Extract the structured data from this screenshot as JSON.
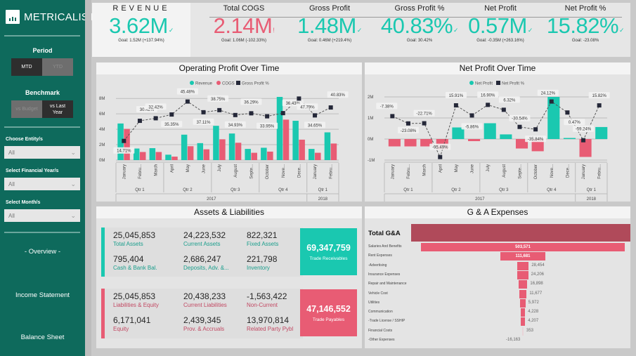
{
  "app": {
    "brand": "METRICALIST"
  },
  "sidebar": {
    "period_label": "Period",
    "period_options": [
      {
        "label": "MTD",
        "selected": true
      },
      {
        "label": "YTD",
        "selected": false
      }
    ],
    "benchmark_label": "Benchmark",
    "benchmark_options": [
      {
        "label": "vs Budget",
        "selected": false
      },
      {
        "label": "vs Last Year",
        "selected": true
      }
    ],
    "filters": [
      {
        "label": "Choose Entity/s",
        "value": "All"
      },
      {
        "label": "Select Financial Year/s",
        "value": "All"
      },
      {
        "label": "Select Month/s",
        "value": "All"
      }
    ],
    "nav": [
      {
        "label": "- Overview -",
        "active": true
      },
      {
        "label": "Income Statement"
      },
      {
        "label": "Balance Sheet"
      }
    ]
  },
  "kpis": [
    {
      "title": "REVENUE",
      "value": "3.62M",
      "indicator": "✓",
      "status": "good",
      "goal": "Goal: 1.52M (+137.94%)"
    },
    {
      "title": "Total COGS",
      "value": "2.14M",
      "indicator": "!",
      "status": "bad",
      "goal": "Goal: 1.06M (-102.33%)"
    },
    {
      "title": "Gross Profit",
      "value": "1.48M",
      "indicator": "✓",
      "status": "good",
      "goal": "Goal: 0.46M (+219.4%)"
    },
    {
      "title": "Gross Profit %",
      "value": "40.83%",
      "indicator": "✓",
      "status": "good",
      "goal": "Goal: 30.42%"
    },
    {
      "title": "Net Profit",
      "value": "0.57M",
      "indicator": "✓",
      "status": "good",
      "goal": "Goal: -0.35M (+263.16%)"
    },
    {
      "title": "Net Profit %",
      "value": "15.82%",
      "indicator": "✓",
      "status": "good",
      "goal": "Goal: -23.08%"
    }
  ],
  "colors": {
    "teal": "#1ac8b0",
    "red": "#e85c74",
    "dark": "#252839",
    "ga_total": "#b04a5a"
  },
  "chart_data": [
    {
      "type": "bar",
      "title": "Operating Profit Over Time",
      "legend": [
        "Revenue",
        "COGS",
        "Gross Profit %"
      ],
      "legend_position": "top-center",
      "categories": [
        "January",
        "Febru...",
        "March",
        "April",
        "May",
        "June",
        "July",
        "August",
        "Septe...",
        "October",
        "Nove...",
        "Dece...",
        "January",
        "Febru..."
      ],
      "quarters": [
        {
          "label": "Qtr 1",
          "span": 3
        },
        {
          "label": "Qtr 2",
          "span": 3
        },
        {
          "label": "Qtr 3",
          "span": 3
        },
        {
          "label": "Qtr 4",
          "span": 3
        },
        {
          "label": "Qtr 1",
          "span": 2
        }
      ],
      "years": [
        {
          "label": "2017",
          "span": 12
        },
        {
          "label": "2018",
          "span": 2
        }
      ],
      "y_ticks": [
        "0M",
        "2M",
        "4M",
        "6M",
        "8M"
      ],
      "ylim": [
        0,
        8.2
      ],
      "series": [
        {
          "name": "Revenue",
          "unit": "M",
          "values": [
            4.75,
            1.5,
            1.55,
            0.7,
            3.3,
            2.2,
            4.45,
            3.45,
            1.45,
            1.6,
            8.2,
            5.1,
            1.45,
            3.6
          ]
        },
        {
          "name": "COGS",
          "unit": "M",
          "values": [
            4.05,
            1.05,
            1.05,
            0.45,
            1.8,
            1.4,
            2.7,
            2.25,
            0.95,
            1.1,
            5.25,
            2.65,
            0.95,
            2.15
          ]
        },
        {
          "name": "Gross Profit %",
          "values": [
            14.71,
            30.42,
            32.42,
            35.35,
            45.48,
            37.11,
            38.75,
            34.93,
            36.29,
            33.95,
            36.43,
            47.79,
            34.65,
            40.83
          ],
          "labels": [
            "14.71%",
            "30.42%",
            "32.42%",
            "35.35%",
            "45.48%",
            "37.11%",
            "38.75%",
            "34.93%",
            "36.29%",
            "33.95%",
            "36.43%",
            "47.79%",
            "34.65%",
            "40.83%"
          ]
        }
      ]
    },
    {
      "type": "bar",
      "title": "Net Profit Over Time",
      "legend": [
        "Net Profit",
        "Net Profit %"
      ],
      "legend_position": "top-center",
      "categories": [
        "January",
        "Febru...",
        "March",
        "April",
        "May",
        "June",
        "July",
        "August",
        "Septe...",
        "October",
        "Nove...",
        "Dece...",
        "January",
        "Febru..."
      ],
      "quarters": [
        {
          "label": "Qtr 1",
          "span": 3
        },
        {
          "label": "Qtr 2",
          "span": 3
        },
        {
          "label": "Qtr 3",
          "span": 3
        },
        {
          "label": "Qtr 4",
          "span": 3
        },
        {
          "label": "Qtr 1",
          "span": 2
        }
      ],
      "years": [
        {
          "label": "2017",
          "span": 12
        },
        {
          "label": "2018",
          "span": 2
        }
      ],
      "y_ticks": [
        "-1M",
        "0M",
        "1M",
        "2M"
      ],
      "ylim": [
        -1,
        2
      ],
      "series": [
        {
          "name": "Net Profit",
          "unit": "M",
          "values": [
            -0.35,
            -0.35,
            -0.35,
            -0.5,
            0.55,
            -0.1,
            0.75,
            0.22,
            -0.45,
            -0.58,
            2.0,
            0.05,
            -0.85,
            0.57
          ]
        },
        {
          "name": "Net Profit %",
          "values": [
            -7.38,
            -23.08,
            -22.71,
            -95.49,
            15.91,
            -5.86,
            16.9,
            6.32,
            -30.54,
            -35.84,
            24.12,
            0.47,
            -59.24,
            15.82
          ],
          "labels": [
            "-7.38%",
            "-23.08%",
            "-22.71%",
            "-95.49%",
            "15.91%",
            "-5.86%",
            "16.90%",
            "6.32%",
            "-30.54%",
            "-35.84%",
            "24.12%",
            "0.47%",
            "-59.24%",
            "15.82%"
          ]
        }
      ]
    },
    {
      "type": "bar",
      "title": "G & A Expenses",
      "total_label": "Total G&A",
      "categories": [
        "Salaries And Benefits",
        "Rent Expenses",
        "-Advertising",
        "Insurance Expenses",
        "Repair and Maintenance",
        "Vehicle Cost",
        "Utilities",
        "Communication",
        "-Trade License / SSHIP",
        "Financial Costs",
        "-Other Expenses"
      ],
      "values": [
        503571,
        111681,
        28454,
        24206,
        16898,
        11677,
        5972,
        4228,
        4207,
        353,
        -16163
      ],
      "labels": [
        "503,571",
        "111,681",
        "28,454",
        "24,206",
        "16,898",
        "11,677",
        "5,972",
        "4,228",
        "4,207",
        "353",
        "-16,163"
      ]
    }
  ],
  "assets_liabilities": {
    "title": "Assets & Liabilities",
    "assets": [
      {
        "value": "25,045,853",
        "label": "Total Assets"
      },
      {
        "value": "24,223,532",
        "label": "Current Assets"
      },
      {
        "value": "822,321",
        "label": "Fixed Assets"
      },
      {
        "value": "795,404",
        "label": "Cash & Bank Bal."
      },
      {
        "value": "2,686,247",
        "label": "Deposits, Adv. &..."
      },
      {
        "value": "221,798",
        "label": "Inventory"
      }
    ],
    "receivables": {
      "value": "69,347,759",
      "label": "Trade Receivables"
    },
    "liabilities": [
      {
        "value": "25,045,853",
        "label": "Liabilities & Equity"
      },
      {
        "value": "20,438,233",
        "label": "Current Liabilities"
      },
      {
        "value": "-1,563,422",
        "label": "Non-Current"
      },
      {
        "value": "6,171,041",
        "label": "Equity"
      },
      {
        "value": "2,439,345",
        "label": "Prov. & Accruals"
      },
      {
        "value": "13,970,814",
        "label": "Related Party Pybl"
      }
    ],
    "payables": {
      "value": "47,146,552",
      "label": "Trade Payables"
    }
  }
}
